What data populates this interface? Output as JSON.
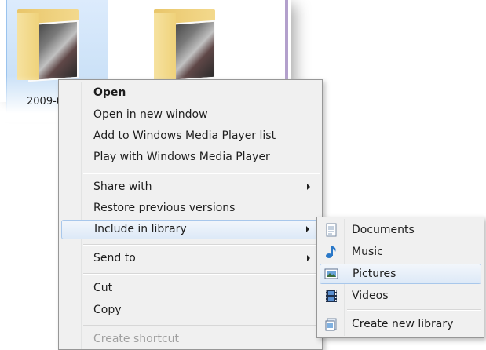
{
  "explorer": {
    "folders": [
      {
        "label": "2009-0",
        "selected": true
      },
      {
        "label": "",
        "selected": false
      }
    ]
  },
  "context_menu": {
    "items": [
      {
        "label": "Open",
        "bold": true
      },
      {
        "label": "Open in new window"
      },
      {
        "label": "Add to Windows Media Player list"
      },
      {
        "label": "Play with Windows Media Player"
      },
      {
        "label": "Share with",
        "submenu": true
      },
      {
        "label": "Restore previous versions"
      },
      {
        "label": "Include in library",
        "submenu": true,
        "highlighted": true
      },
      {
        "label": "Send to",
        "submenu": true
      },
      {
        "label": "Cut"
      },
      {
        "label": "Copy"
      },
      {
        "label": "Create shortcut",
        "disabled": true
      }
    ]
  },
  "library_submenu": {
    "items": [
      {
        "label": "Documents",
        "icon": "documents-library-icon"
      },
      {
        "label": "Music",
        "icon": "music-note-icon"
      },
      {
        "label": "Pictures",
        "icon": "pictures-library-icon",
        "highlighted": true
      },
      {
        "label": "Videos",
        "icon": "film-strip-icon"
      },
      {
        "label": "Create new library",
        "icon": "new-library-icon"
      }
    ]
  },
  "colors": {
    "menu_background": "#f0f0f0",
    "highlight_border": "#a8c7eb",
    "selection_tile": "#cfe3f8"
  }
}
